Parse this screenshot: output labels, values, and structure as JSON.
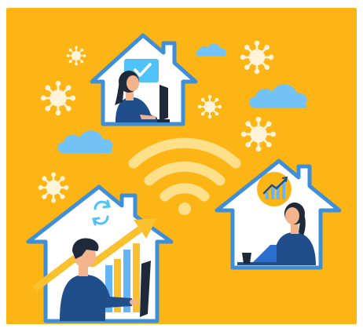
{
  "illustration": {
    "colors": {
      "background": "#FDB515",
      "house_outline": "#3E8FD8",
      "house_inner": "#FFFFFF",
      "virus": "#FFF4DA",
      "cloud": "#72C2F6",
      "wifi": "#FFE08A",
      "person_blue": "#1F4E8A",
      "person_dark": "#1E2A3A",
      "skin": "#F3B38D",
      "chart_yellow": "#FBC02D",
      "chart_blue": "#64B5F6",
      "laptop": "#2A6FD0",
      "check_box": "#4FC3F7"
    },
    "icons": [
      "house-icon",
      "virus-icon",
      "cloud-icon",
      "wifi-icon",
      "checkmark-icon",
      "bar-chart-icon",
      "refresh-icon",
      "laptop-icon",
      "monitor-icon",
      "coffee-cup-icon",
      "trend-arrow-icon"
    ]
  }
}
